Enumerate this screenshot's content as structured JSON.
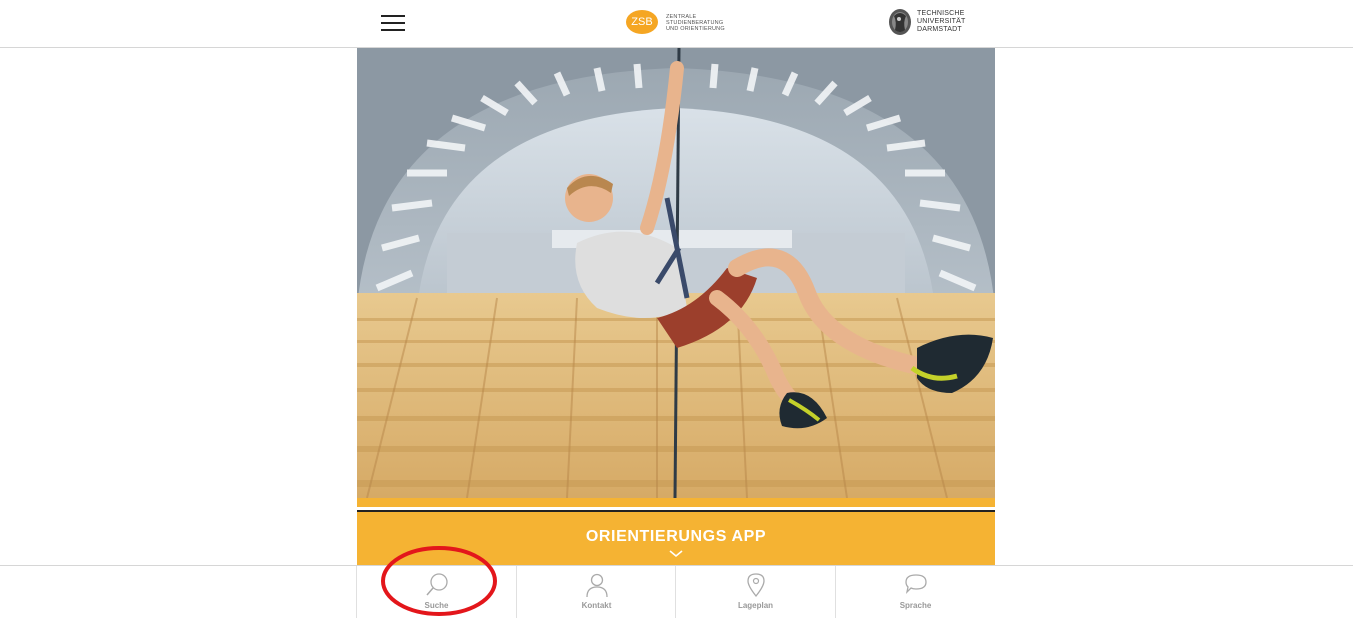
{
  "header": {
    "menu_icon": "hamburger-menu-icon",
    "zsb_logo": {
      "badge": "ZSB",
      "text": "ZENTRALE\nSTUDIENBERATUNG\nUND ORIENTIERUNG"
    },
    "tu_logo": {
      "text": "TECHNISCHE\nUNIVERSITÄT\nDARMSTADT"
    }
  },
  "banner": {
    "title": "ORIENTIERUNGS APP",
    "chevron_icon": "chevron-down-icon"
  },
  "tabs": [
    {
      "label": "Suche",
      "icon": "search-icon"
    },
    {
      "label": "Kontakt",
      "icon": "person-icon"
    },
    {
      "label": "Lageplan",
      "icon": "map-pin-icon"
    },
    {
      "label": "Sprache",
      "icon": "speech-bubble-icon"
    }
  ],
  "colors": {
    "accent": "#f5b333",
    "annotation": "#e3161b",
    "tab_text": "#999999"
  }
}
